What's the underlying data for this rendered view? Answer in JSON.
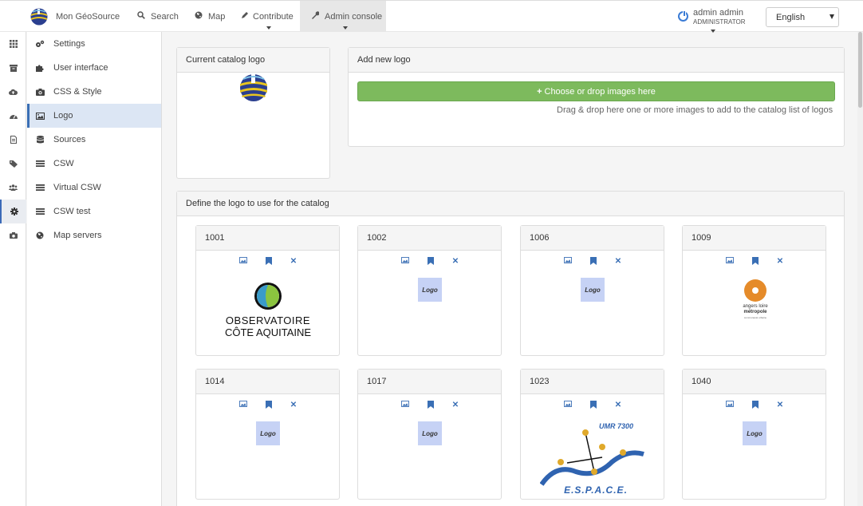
{
  "navbar": {
    "site_name": "Mon GéoSource",
    "search": "Search",
    "map": "Map",
    "contribute": "Contribute",
    "admin_console": "Admin console",
    "user_name": "admin admin",
    "user_role": "ADMINISTRATOR",
    "language": "English"
  },
  "rail": {
    "items": [
      "grid-icon",
      "archive-icon",
      "cloud-upload-icon",
      "dashboard-icon",
      "file-icon",
      "tags-icon",
      "users-icon",
      "gear-icon",
      "camera-icon"
    ],
    "active_index": 7
  },
  "submenu": {
    "items": [
      {
        "label": "Settings",
        "icon": "gears-icon"
      },
      {
        "label": "User interface",
        "icon": "puzzle-icon"
      },
      {
        "label": "CSS & Style",
        "icon": "camera-icon"
      },
      {
        "label": "Logo",
        "icon": "picture-icon"
      },
      {
        "label": "Sources",
        "icon": "database-icon"
      },
      {
        "label": "CSW",
        "icon": "list-icon"
      },
      {
        "label": "Virtual CSW",
        "icon": "list-icon"
      },
      {
        "label": "CSW test",
        "icon": "list-icon"
      },
      {
        "label": "Map servers",
        "icon": "globe-icon"
      }
    ],
    "active_index": 3
  },
  "current_logo": {
    "title": "Current catalog logo"
  },
  "add_logo": {
    "title": "Add new logo",
    "button_label": "Choose or drop images here",
    "hint": "Drag & drop here one or more images to add to the catalog list of logos"
  },
  "define_logo": {
    "title": "Define the logo to use for the catalog",
    "cards": [
      {
        "id": "1001",
        "logo": "observatoire-cote-aquitaine",
        "text1": "OBSERVATOIRE",
        "text2": "CÔTE AQUITAINE"
      },
      {
        "id": "1002",
        "logo": "placeholder",
        "text": "Logo"
      },
      {
        "id": "1006",
        "logo": "placeholder",
        "text": "Logo"
      },
      {
        "id": "1009",
        "logo": "angers-loire-metropole",
        "text1": "angers loire",
        "text2": "métropole",
        "text3": "communauté urbaine"
      },
      {
        "id": "1014",
        "logo": "placeholder",
        "text": "Logo"
      },
      {
        "id": "1017",
        "logo": "placeholder",
        "text": "Logo"
      },
      {
        "id": "1023",
        "logo": "umr-7300-espace",
        "text1": "UMR 7300",
        "text2": "E.S.P.A.C.E."
      },
      {
        "id": "1040",
        "logo": "placeholder",
        "text": "Logo"
      }
    ]
  },
  "colors": {
    "accent": "#3a6fb5",
    "button_green": "#7dba5d"
  }
}
